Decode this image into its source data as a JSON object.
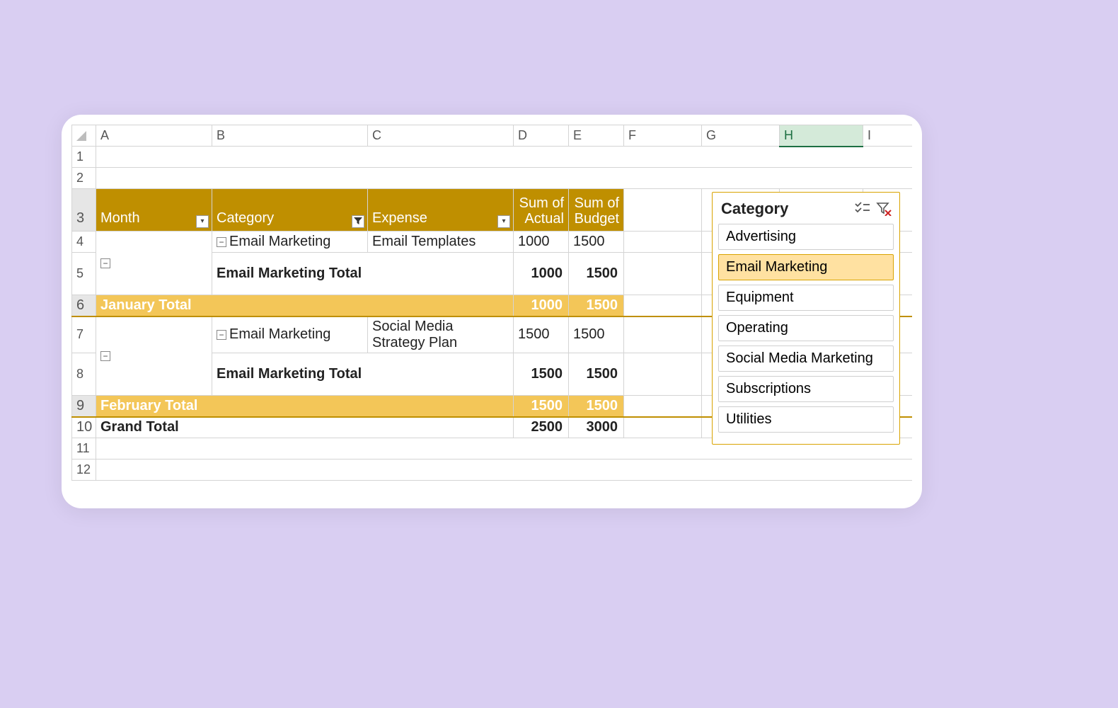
{
  "columns": [
    "A",
    "B",
    "C",
    "D",
    "E",
    "F",
    "G",
    "H",
    "I"
  ],
  "active_column": "H",
  "row_numbers": [
    "1",
    "2",
    "3",
    "4",
    "5",
    "6",
    "7",
    "8",
    "9",
    "10",
    "11",
    "12"
  ],
  "pivot_headers": {
    "month": "Month",
    "category": "Category",
    "expense": "Expense",
    "actual": "Sum of Actual",
    "budget": "Sum of Budget"
  },
  "rows": {
    "jan": {
      "month": "January",
      "category": "Email Marketing",
      "expense": "Email Templates",
      "actual": "1000",
      "budget": "1500",
      "cat_total_label": "Email Marketing Total",
      "cat_total_actual": "1000",
      "cat_total_budget": "1500",
      "month_total_label": "January Total",
      "month_total_actual": "1000",
      "month_total_budget": "1500"
    },
    "feb": {
      "month": "February",
      "category": "Email Marketing",
      "expense": "Social Media Strategy Plan",
      "actual": "1500",
      "budget": "1500",
      "cat_total_label": "Email Marketing Total",
      "cat_total_actual": "1500",
      "cat_total_budget": "1500",
      "month_total_label": "February Total",
      "month_total_actual": "1500",
      "month_total_budget": "1500"
    },
    "grand": {
      "label": "Grand Total",
      "actual": "2500",
      "budget": "3000"
    }
  },
  "slicer": {
    "title": "Category",
    "items": [
      "Advertising",
      "Email Marketing",
      "Equipment",
      "Operating",
      "Social Media Marketing",
      "Subscriptions",
      "Utilities"
    ],
    "selected_index": 1
  }
}
